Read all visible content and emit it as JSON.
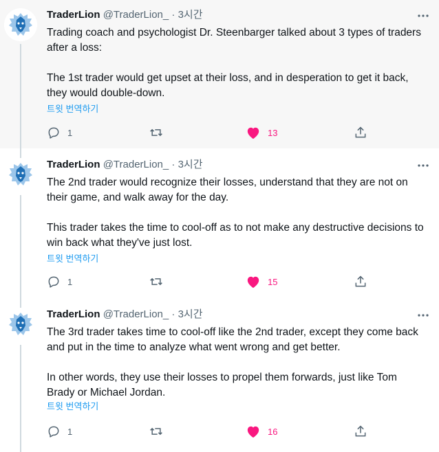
{
  "tweets": [
    {
      "author": "TraderLion",
      "handle": "@TraderLion_",
      "separator": "·",
      "time": "3시간",
      "paragraphs": [
        "Trading coach and psychologist Dr. Steenbarger talked about 3 types of traders after a loss:",
        "The 1st trader would get upset at their loss, and in desperation to get it back, they would double-down."
      ],
      "translate_label": "트윗 번역하기",
      "replies": "1",
      "retweets": "",
      "likes": "13"
    },
    {
      "author": "TraderLion",
      "handle": "@TraderLion_",
      "separator": "·",
      "time": "3시간",
      "paragraphs": [
        "The 2nd trader would recognize their losses, understand that they are not on their game, and walk away for the day.",
        "This trader takes the time to cool-off as to not make any destructive decisions to win back what they've just lost."
      ],
      "translate_label": "트윗 번역하기",
      "replies": "1",
      "retweets": "",
      "likes": "15"
    },
    {
      "author": "TraderLion",
      "handle": "@TraderLion_",
      "separator": "·",
      "time": "3시간",
      "paragraphs": [
        "The 3rd trader takes time to cool-off like the 2nd trader, except they come back and put in the time to analyze what went wrong and get better.",
        "In other words, they use their losses to propel them forwards, just like Tom Brady or Michael Jordan."
      ],
      "translate_label": "트윗 번역하기",
      "replies": "1",
      "retweets": "",
      "likes": "16"
    }
  ],
  "icons": {
    "avatar": "lion-logo-icon",
    "more": "more-options-icon",
    "reply": "reply-icon",
    "retweet": "retweet-icon",
    "like": "heart-filled-icon",
    "share": "share-icon"
  },
  "colors": {
    "accent": "#1d9bf0",
    "like": "#f91880",
    "text": "#0f1419",
    "secondary": "#536471",
    "highlight_background": "#f7f7f7"
  }
}
